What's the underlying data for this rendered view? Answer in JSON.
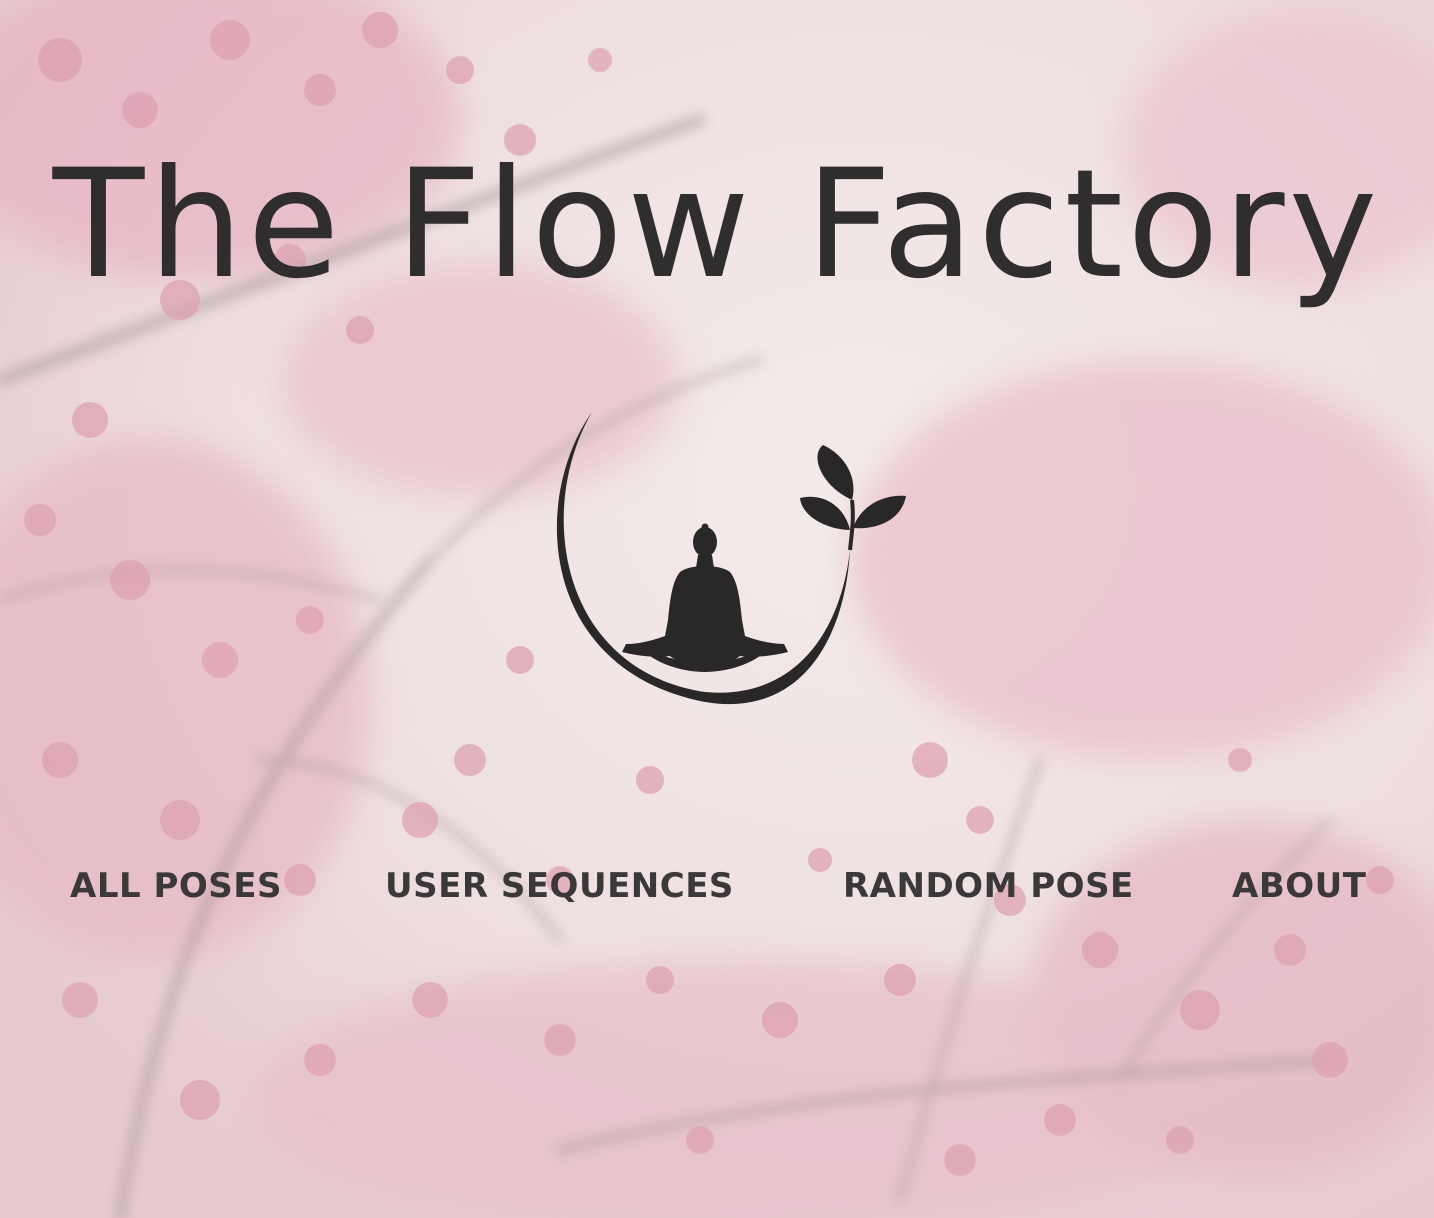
{
  "site": {
    "title": "The Flow Factory"
  },
  "logo": {
    "icon": "meditating-figure-moon-leaves-icon"
  },
  "nav": {
    "items": [
      {
        "label": "ALL POSES"
      },
      {
        "label": "USER SEQUENCES"
      },
      {
        "label": "RANDOM POSE"
      },
      {
        "label": "ABOUT"
      }
    ]
  },
  "colors": {
    "text": "#2f2d2e",
    "blossom": "#d98aa0",
    "background": "#eadcdc"
  }
}
